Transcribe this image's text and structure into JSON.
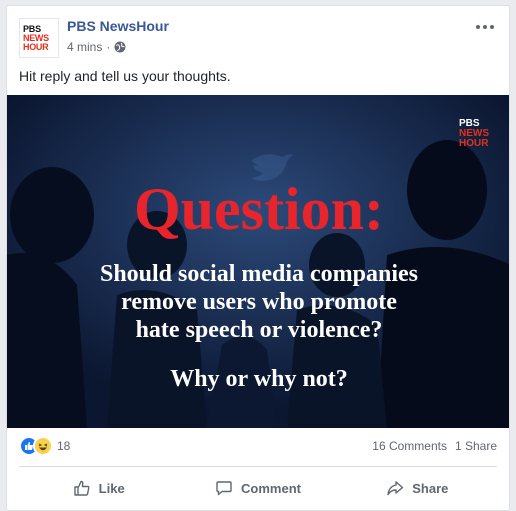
{
  "post": {
    "page_name": "PBS NewsHour",
    "time": "4 mins",
    "meta_separator": "·",
    "caption": "Hit reply and tell us your thoughts.",
    "avatar_logo": {
      "line1": "PBS",
      "line2": "NEWS",
      "line3": "HOUR"
    },
    "privacy_icon": "globe-icon",
    "more_icon": "more-horizontal-icon"
  },
  "media": {
    "logo": {
      "line1": "PBS",
      "line2": "NEWS",
      "line3": "HOUR"
    },
    "heading": "Question:",
    "body_lines": [
      "Should social media companies",
      "remove users who promote",
      "hate speech or violence?"
    ],
    "followup": "Why or why not?",
    "colors": {
      "background": "#0d1a33",
      "heading": "#e8252c",
      "text": "#ffffff"
    }
  },
  "stats": {
    "reaction_icons": [
      "like-reaction-icon",
      "haha-reaction-icon"
    ],
    "reaction_count": "18",
    "comments": "16 Comments",
    "shares": "1 Share"
  },
  "actions": {
    "like": "Like",
    "comment": "Comment",
    "share": "Share"
  },
  "colors": {
    "link": "#385898",
    "secondary_text": "#606770",
    "accent": "#1877f2"
  }
}
